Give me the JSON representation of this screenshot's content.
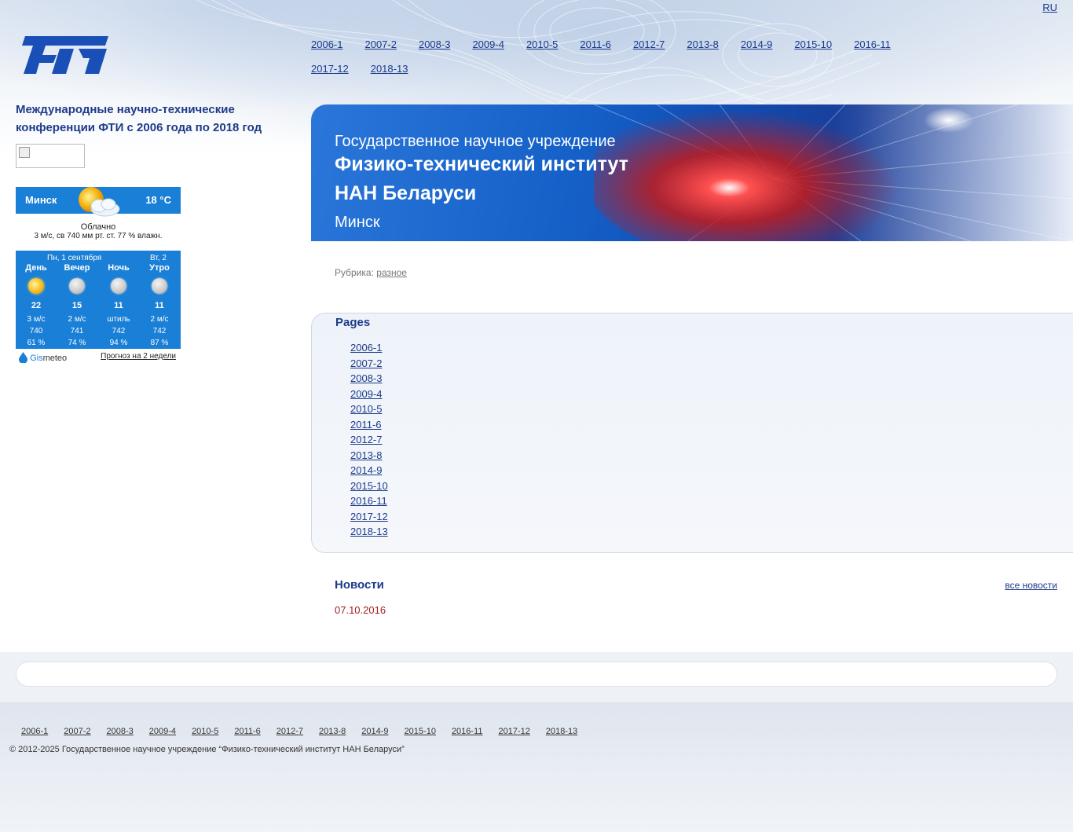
{
  "lang": "RU",
  "nav": {
    "items": [
      "2006-1",
      "2007-2",
      "2008-3",
      "2009-4",
      "2010-5",
      "2011-6",
      "2012-7",
      "2013-8",
      "2014-9",
      "2015-10",
      "2016-11",
      "2017-12",
      "2018-13"
    ]
  },
  "sidebar": {
    "title": "Международные научно-технические конференции ФТИ с 2006 года по 2018 год"
  },
  "weather": {
    "city": "Минск",
    "temp": "18 °C",
    "desc": "Облачно",
    "details": "3 м/с, св 740 мм рт. ст. 77 % влажн.",
    "date1": "Пн, 1 сентября",
    "date2": "Вт, 2",
    "columns": [
      {
        "label": "День",
        "icon": "sun-icon",
        "temp": "22",
        "wind": "3 м/с",
        "pressure": "740",
        "humidity": "61 %"
      },
      {
        "label": "Вечер",
        "icon": "moon-icon",
        "temp": "15",
        "wind": "2 м/с",
        "pressure": "741",
        "humidity": "74 %"
      },
      {
        "label": "Ночь",
        "icon": "moon-icon",
        "temp": "11",
        "wind": "штиль",
        "pressure": "742",
        "humidity": "94 %"
      },
      {
        "label": "Утро",
        "icon": "moon-icon",
        "temp": "11",
        "wind": "2 м/с",
        "pressure": "742",
        "humidity": "87 %"
      }
    ],
    "brand_gis": "Gis",
    "brand_meteo": "meteo",
    "forecast_link": "Прогноз на 2 недели"
  },
  "banner": {
    "line1": "Государственное научное учреждение",
    "line2": "Физико-технический институт",
    "line3": "НАН Беларуси",
    "line4": "Минск"
  },
  "rubric": {
    "label": "Рубрика:",
    "link": "разное"
  },
  "pages": {
    "title": "Pages",
    "items": [
      "2006-1",
      "2007-2",
      "2008-3",
      "2009-4",
      "2010-5",
      "2011-6",
      "2012-7",
      "2013-8",
      "2014-9",
      "2015-10",
      "2016-11",
      "2017-12",
      "2018-13"
    ]
  },
  "news": {
    "title": "Новости",
    "all_link": "все новости",
    "date": "07.10.2016"
  },
  "footer": {
    "items": [
      "2006-1",
      "2007-2",
      "2008-3",
      "2009-4",
      "2010-5",
      "2011-6",
      "2012-7",
      "2013-8",
      "2014-9",
      "2015-10",
      "2016-11",
      "2017-12",
      "2018-13"
    ],
    "copyright": "© 2012-2025 Государственное научное учреждение “Физико-технический институт НАН Беларуси”"
  }
}
